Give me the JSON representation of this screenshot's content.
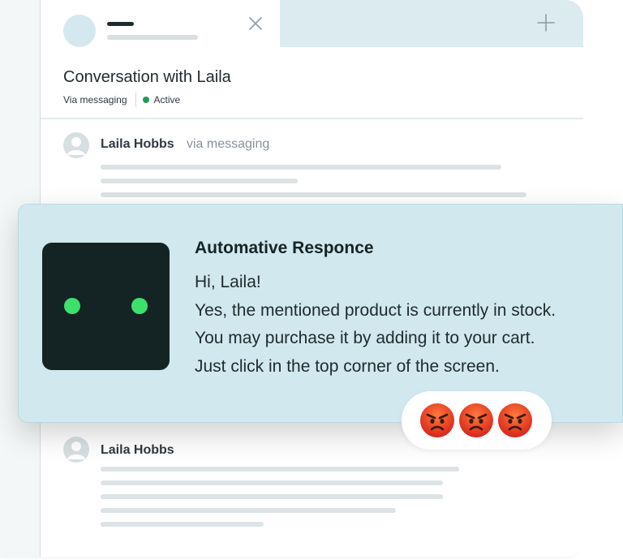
{
  "conversation": {
    "title": "Conversation with Laila",
    "channel": "Via messaging",
    "status": "Active",
    "status_color": "#1f9a55"
  },
  "messages": [
    {
      "sender": "Laila Hobbs",
      "via": "via messaging"
    },
    {
      "sender": "Laila Hobbs"
    }
  ],
  "auto_response": {
    "title": "Automative Responce",
    "lines": [
      "Hi, Laila!",
      "Yes, the mentioned product is currently in stock.",
      "You may purchase it by adding it to your cart.",
      "Just click in the top corner of the screen."
    ]
  },
  "reactions": [
    "angry-face-icon",
    "angry-face-icon",
    "angry-face-icon"
  ],
  "colors": {
    "popup_background": "#d2e8ef",
    "robot_background": "#142424",
    "robot_eyes": "#3ee06c",
    "inactive_tab": "#dcebf0"
  }
}
